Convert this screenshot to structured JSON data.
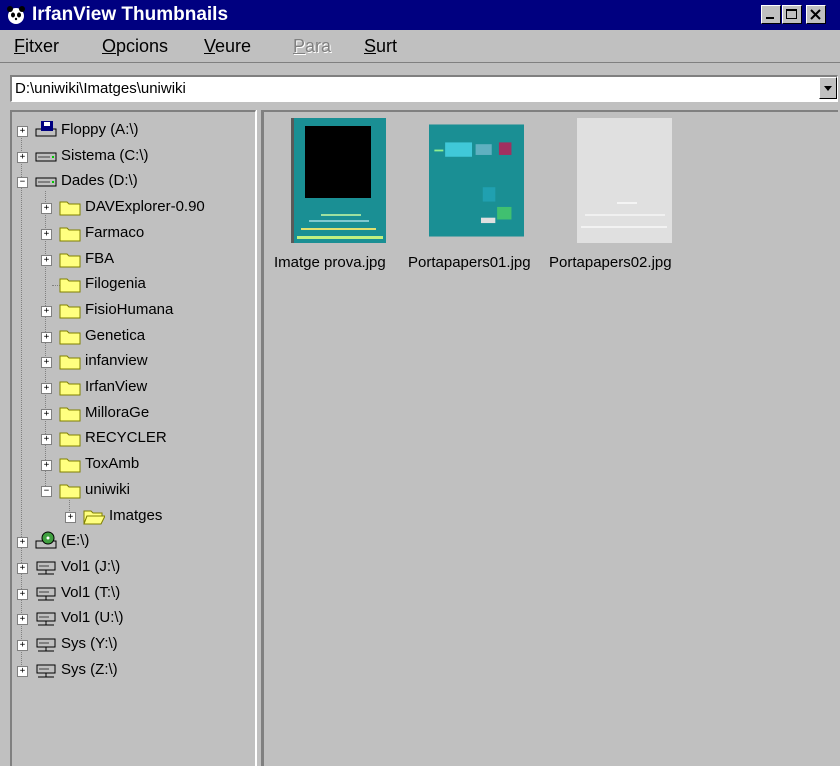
{
  "window": {
    "title": "IrfanView Thumbnails",
    "icon": "panda-icon"
  },
  "menu": [
    {
      "label": "Fitxer",
      "access": "F",
      "rest": "itxer",
      "enabled": true
    },
    {
      "label": "Opcions",
      "access": "O",
      "rest": "pcions",
      "enabled": true
    },
    {
      "label": "Veure",
      "access": "V",
      "rest": "eure",
      "enabled": true
    },
    {
      "label": "Para",
      "access": "P",
      "rest": "ara",
      "enabled": false
    },
    {
      "label": "Surt",
      "access": "S",
      "rest": "urt",
      "enabled": true
    }
  ],
  "path": {
    "value": "D:\\uniwiki\\Imatges\\uniwiki"
  },
  "tree": [
    {
      "label": "Floppy (A:\\)",
      "icon": "floppy-drive-icon",
      "expander": "+"
    },
    {
      "label": "Sistema (C:\\)",
      "icon": "hard-drive-icon",
      "expander": "+"
    },
    {
      "label": "Dades (D:\\)",
      "icon": "hard-drive-icon",
      "expander": "−"
    },
    {
      "label": "DAVExplorer-0.90",
      "icon": "folder-icon",
      "expander": "+"
    },
    {
      "label": "Farmaco",
      "icon": "folder-icon",
      "expander": "+"
    },
    {
      "label": "FBA",
      "icon": "folder-icon",
      "expander": "+"
    },
    {
      "label": "Filogenia",
      "icon": "folder-icon",
      "expander": ""
    },
    {
      "label": "FisioHumana",
      "icon": "folder-icon",
      "expander": "+"
    },
    {
      "label": "Genetica",
      "icon": "folder-icon",
      "expander": "+"
    },
    {
      "label": "infanview",
      "icon": "folder-icon",
      "expander": "+"
    },
    {
      "label": "IrfanView",
      "icon": "folder-icon",
      "expander": "+"
    },
    {
      "label": "MilloraGe",
      "icon": "folder-icon",
      "expander": "+"
    },
    {
      "label": "RECYCLER",
      "icon": "folder-icon",
      "expander": "+"
    },
    {
      "label": "ToxAmb",
      "icon": "folder-icon",
      "expander": "+"
    },
    {
      "label": "uniwiki",
      "icon": "folder-icon",
      "expander": "−"
    },
    {
      "label": "Imatges",
      "icon": "open-folder-icon",
      "expander": "+"
    },
    {
      "label": "(E:\\)",
      "icon": "cd-drive-icon",
      "expander": "+"
    },
    {
      "label": "Vol1 (J:\\)",
      "icon": "network-drive-icon",
      "expander": "+"
    },
    {
      "label": "Vol1 (T:\\)",
      "icon": "network-drive-icon",
      "expander": "+"
    },
    {
      "label": "Vol1 (U:\\)",
      "icon": "network-drive-icon",
      "expander": "+"
    },
    {
      "label": "Sys (Y:\\)",
      "icon": "network-drive-icon",
      "expander": "+"
    },
    {
      "label": "Sys (Z:\\)",
      "icon": "network-drive-icon",
      "expander": "+"
    }
  ],
  "thumbnails": [
    {
      "filename": "Imatge prova.jpg",
      "icon": "thumbnail-image"
    },
    {
      "filename": "Portapapers01.jpg",
      "icon": "thumbnail-image"
    },
    {
      "filename": "Portapapers02.jpg",
      "icon": "thumbnail-image"
    }
  ],
  "colors": {
    "titlebar": "#000080",
    "face": "#c0c0c0",
    "folder": "#ffff80",
    "thumb_teal": "#1a8f94"
  }
}
